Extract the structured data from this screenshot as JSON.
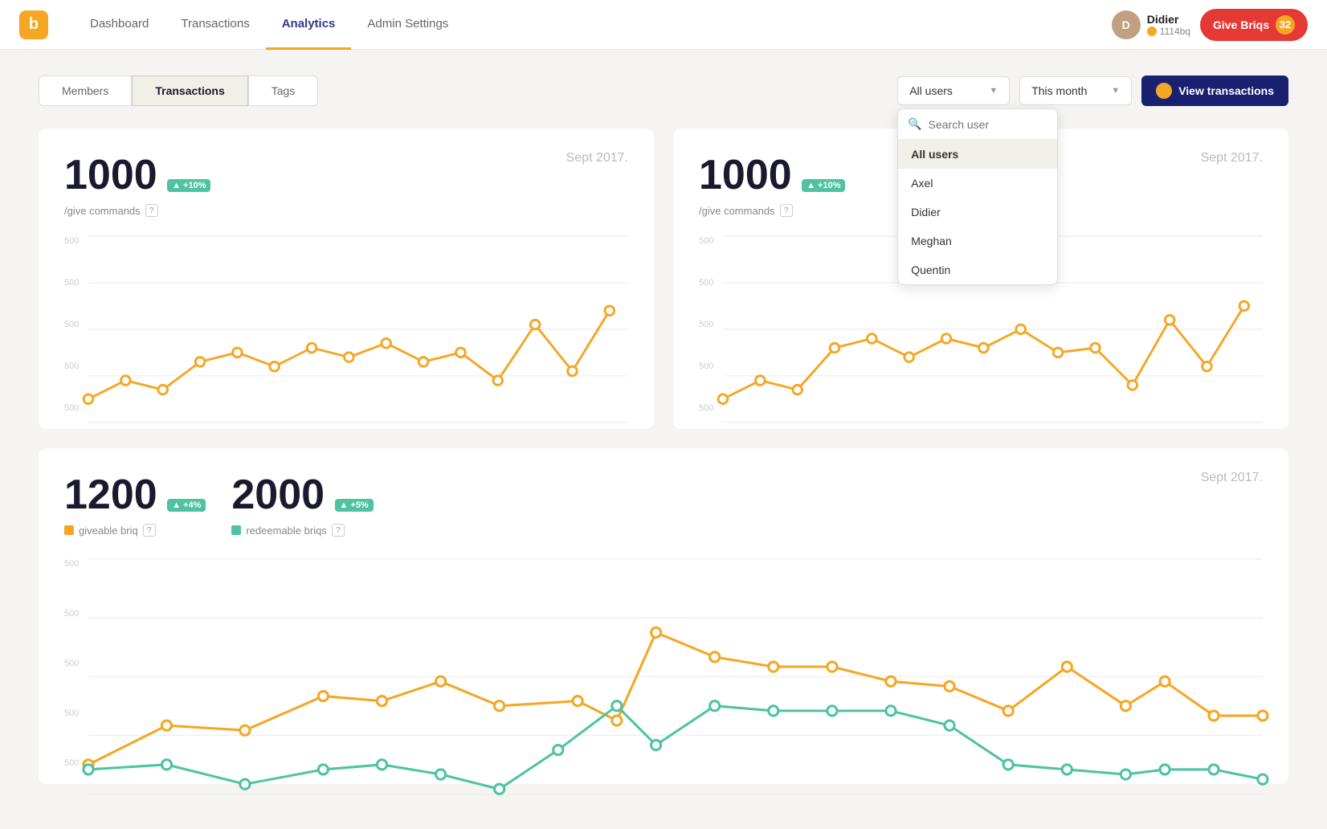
{
  "app": {
    "logo": "b",
    "logo_color": "#f5a623"
  },
  "nav": {
    "links": [
      {
        "id": "dashboard",
        "label": "Dashboard",
        "active": false
      },
      {
        "id": "transactions",
        "label": "Transactions",
        "active": false
      },
      {
        "id": "analytics",
        "label": "Analytics",
        "active": true
      },
      {
        "id": "admin-settings",
        "label": "Admin Settings",
        "active": false
      }
    ],
    "user": {
      "name": "Didier",
      "coins": "1114bq",
      "initials": "D"
    },
    "give_briqs": {
      "label": "Give Briqs",
      "count": "32"
    }
  },
  "tabs": {
    "items": [
      {
        "id": "members",
        "label": "Members"
      },
      {
        "id": "transactions",
        "label": "Transactions"
      },
      {
        "id": "tags",
        "label": "Tags"
      }
    ],
    "active": "transactions"
  },
  "filters": {
    "user_dropdown": {
      "label": "All users",
      "options": [
        {
          "id": "all",
          "label": "All users",
          "selected": true
        },
        {
          "id": "axel",
          "label": "Axel"
        },
        {
          "id": "didier",
          "label": "Didier"
        },
        {
          "id": "meghan",
          "label": "Meghan"
        },
        {
          "id": "quentin",
          "label": "Quentin"
        }
      ]
    },
    "period_dropdown": {
      "label": "This month"
    },
    "search_placeholder": "Search user",
    "view_btn": "View transactions"
  },
  "card1": {
    "stat": "1000",
    "badge": "+10%",
    "label": "/give commands",
    "date": "Sept 2017.",
    "y_labels": [
      "500",
      "500",
      "500",
      "500",
      "500"
    ]
  },
  "card2": {
    "stat": "1000",
    "badge": "+10%",
    "label": "/give commands",
    "date": "Sept 2017.",
    "y_labels": [
      "500",
      "500",
      "500",
      "500",
      "500"
    ]
  },
  "card3": {
    "stat1": "1200",
    "badge1": "+4%",
    "label1": "giveable briq",
    "stat2": "2000",
    "badge2": "+5%",
    "label2": "redeemable briqs",
    "date": "Sept 2017.",
    "y_labels": [
      "500",
      "500",
      "500",
      "500",
      "500"
    ]
  },
  "colors": {
    "gold": "#f5a623",
    "teal": "#4fc3a1",
    "navy": "#1a2070",
    "red": "#e53935"
  }
}
